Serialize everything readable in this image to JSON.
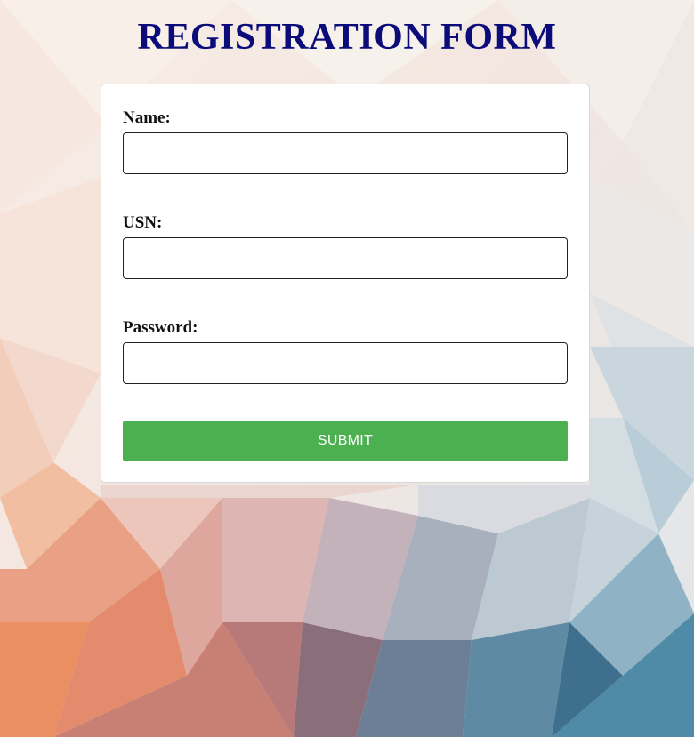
{
  "page": {
    "title": "REGISTRATION FORM"
  },
  "form": {
    "fields": [
      {
        "label": "Name:",
        "value": "",
        "placeholder": "",
        "type": "text"
      },
      {
        "label": "USN:",
        "value": "",
        "placeholder": "",
        "type": "text"
      },
      {
        "label": "Password:",
        "value": "",
        "placeholder": "",
        "type": "password"
      }
    ],
    "submit_label": "SUBMIT"
  },
  "colors": {
    "title": "#0b0b7a",
    "submit_button": "#4caf50",
    "card": "#ffffff"
  }
}
